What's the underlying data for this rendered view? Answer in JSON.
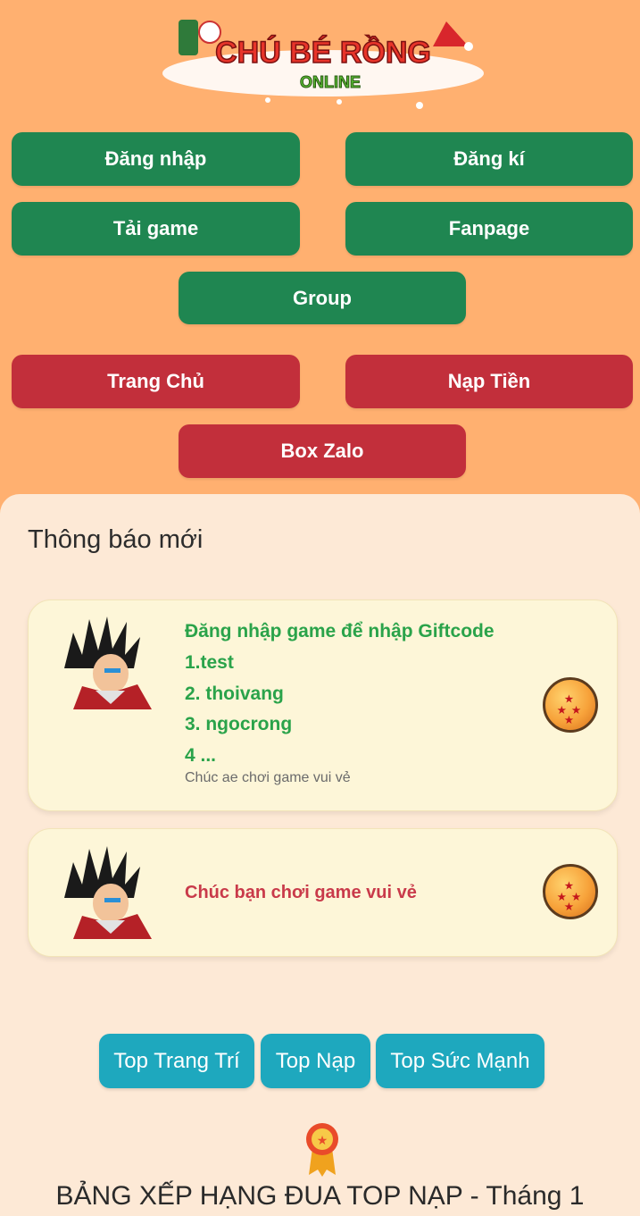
{
  "header": {
    "logo_text": "CHÚ BÉ RỒNG",
    "logo_subtext": "ONLINE"
  },
  "nav": {
    "login": "Đăng nhập",
    "register": "Đăng kí",
    "download": "Tải game",
    "fanpage": "Fanpage",
    "group": "Group",
    "home": "Trang Chủ",
    "topup": "Nạp Tiền",
    "zalo": "Box Zalo"
  },
  "colors": {
    "background": "#ffb070",
    "green_button": "#1f8651",
    "red_button": "#c22f3b",
    "panel": "#fde9d6",
    "tab": "#1ea8be"
  },
  "news": {
    "title": "Thông báo mới",
    "items": [
      {
        "lines": [
          "Đăng nhập game để nhập Giftcode",
          "1.test",
          "2. thoivang",
          "3. ngocrong",
          "4 ..."
        ],
        "subtext": "Chúc ae chơi game vui vẻ",
        "avatar_icon": "saiyan-character-icon",
        "badge_icon": "dragon-ball-icon"
      },
      {
        "text": "Chúc bạn chơi game vui vẻ",
        "avatar_icon": "saiyan-character-icon",
        "badge_icon": "dragon-ball-icon"
      }
    ]
  },
  "ranking": {
    "tabs": [
      "Top Trang Trí",
      "Top Nạp",
      "Top Sức Mạnh"
    ],
    "medal_icon": "medal-icon",
    "title": "BẢNG XẾP HẠNG ĐUA TOP NẠP - Tháng 1"
  }
}
